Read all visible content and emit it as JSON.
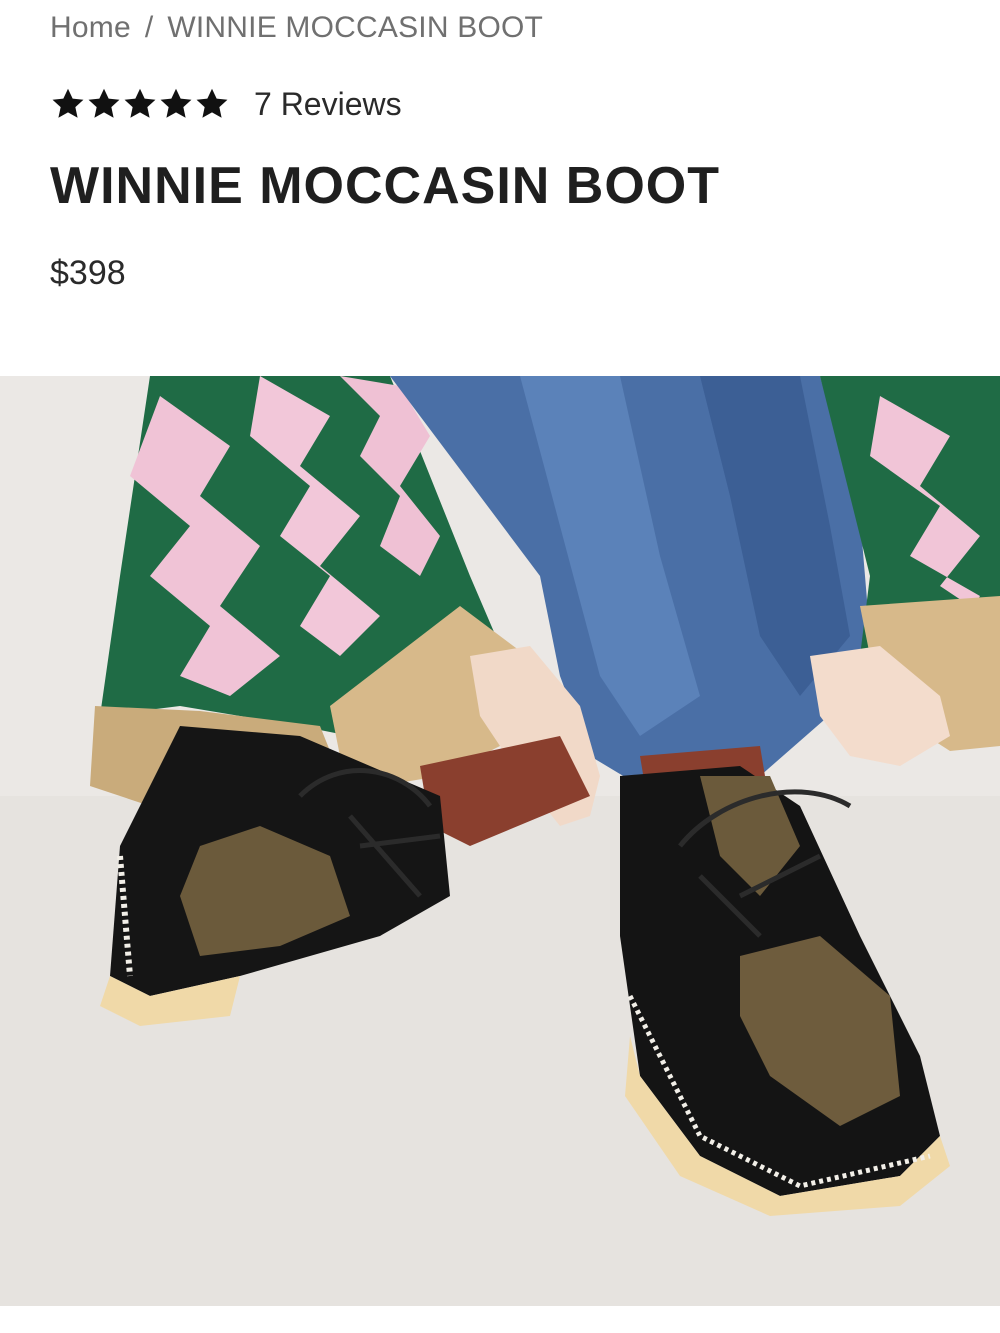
{
  "breadcrumb": {
    "home": "Home",
    "separator": "/",
    "current": "WINNIE MOCCASIN BOOT"
  },
  "rating": {
    "stars": 5,
    "star_icon": "star-icon",
    "reviews_label": "7 Reviews"
  },
  "product": {
    "title": "WINNIE MOCCASIN BOOT",
    "price": "$398"
  },
  "image": {
    "alt": "Model wearing black suede lace-up moccasin boots with shearling trim, jeans and a green and pink knit cardigan"
  },
  "colors": {
    "text": "#1c1c1c",
    "muted": "#707070",
    "background": "#ffffff"
  }
}
